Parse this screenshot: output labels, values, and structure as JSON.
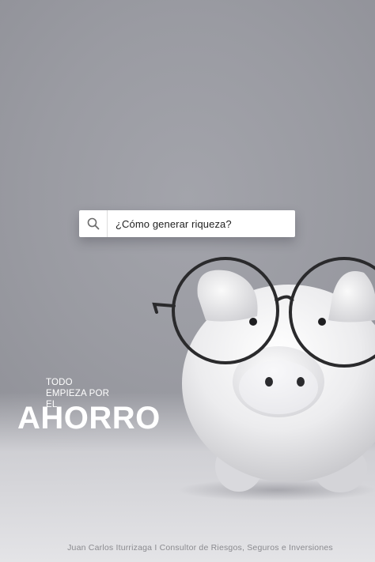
{
  "search": {
    "query": "¿Cómo generar riqueza?",
    "icon": "search-icon"
  },
  "tagline": {
    "line1": "TODO",
    "line2": "EMPIEZA POR",
    "line3": "EL"
  },
  "headline": "AHORRO",
  "footer": "Juan Carlos Iturrizaga I Consultor de Riesgos, Seguros e Inversiones",
  "colors": {
    "background": "#9a9ba2",
    "text": "#ffffff",
    "glasses": "#2a2a2c",
    "piggy": "#f2f2f2"
  }
}
